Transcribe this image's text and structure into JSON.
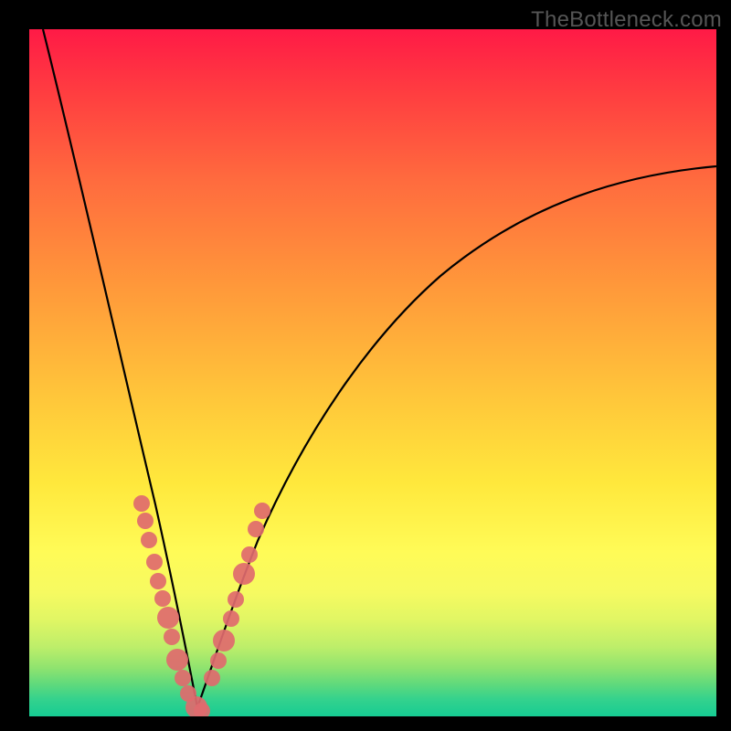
{
  "watermark": "TheBottleneck.com",
  "chart_data": {
    "type": "line",
    "title": "",
    "xlabel": "",
    "ylabel": "",
    "xlim": [
      0,
      100
    ],
    "ylim": [
      0,
      100
    ],
    "grid": false,
    "legend": false,
    "note": "Two-armed bottleneck curve over a red-to-green performance gradient. No axis ticks or numeric labels are shown; values are traced from pixel positions (0-100 normalized).",
    "series": [
      {
        "name": "bottleneck-curve-left",
        "x": [
          2,
          4,
          6,
          8,
          10,
          12,
          14,
          16,
          18,
          20,
          22,
          24
        ],
        "y": [
          100,
          92,
          83,
          73,
          62,
          51,
          40,
          29,
          19,
          10,
          3,
          0
        ]
      },
      {
        "name": "bottleneck-curve-right",
        "x": [
          24,
          26,
          30,
          35,
          40,
          46,
          52,
          60,
          68,
          76,
          84,
          92,
          100
        ],
        "y": [
          0,
          5,
          13,
          22,
          30,
          38,
          45,
          53,
          60,
          66,
          71,
          76,
          80
        ]
      },
      {
        "name": "curve-markers-left",
        "type": "scatter",
        "x": [
          16.4,
          16.9,
          17.4,
          18.2,
          18.8,
          19.4,
          20.2,
          20.8,
          21.6,
          22.4,
          23.2,
          24.4,
          25.2
        ],
        "y": [
          31.0,
          28.4,
          25.6,
          22.4,
          19.6,
          17.2,
          14.3,
          11.6,
          8.3,
          5.6,
          3.3,
          1.3,
          0.8
        ]
      },
      {
        "name": "curve-markers-right",
        "type": "scatter",
        "x": [
          26.6,
          27.5,
          28.3,
          29.4,
          30.1,
          31.2,
          32.0,
          33.0,
          33.9
        ],
        "y": [
          5.6,
          8.1,
          11.0,
          14.2,
          17.1,
          20.7,
          23.6,
          27.3,
          29.9
        ]
      }
    ],
    "gradient_bands": [
      {
        "y": 100,
        "color": "#ff1a46"
      },
      {
        "y": 66,
        "color": "#ffe83c"
      },
      {
        "y": 0,
        "color": "#16cc93"
      }
    ]
  }
}
